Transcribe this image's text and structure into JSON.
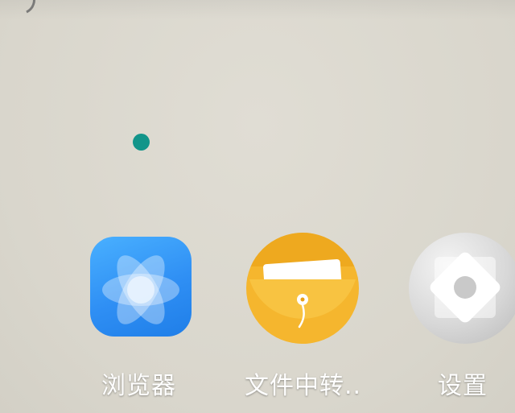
{
  "home_screen": {
    "apps": [
      {
        "label": "浏览器",
        "icon": "browser-atom-icon"
      },
      {
        "label": "文件中转..",
        "icon": "file-folder-icon"
      },
      {
        "label": "设置",
        "icon": "settings-gear-icon"
      }
    ],
    "indicator_color": "#12958a"
  },
  "colors": {
    "wallpaper": "#dcd9cf",
    "browser_blue": "#2f8ff4",
    "files_yellow": "#f5b62e",
    "settings_gray": "#d8d8d8"
  }
}
